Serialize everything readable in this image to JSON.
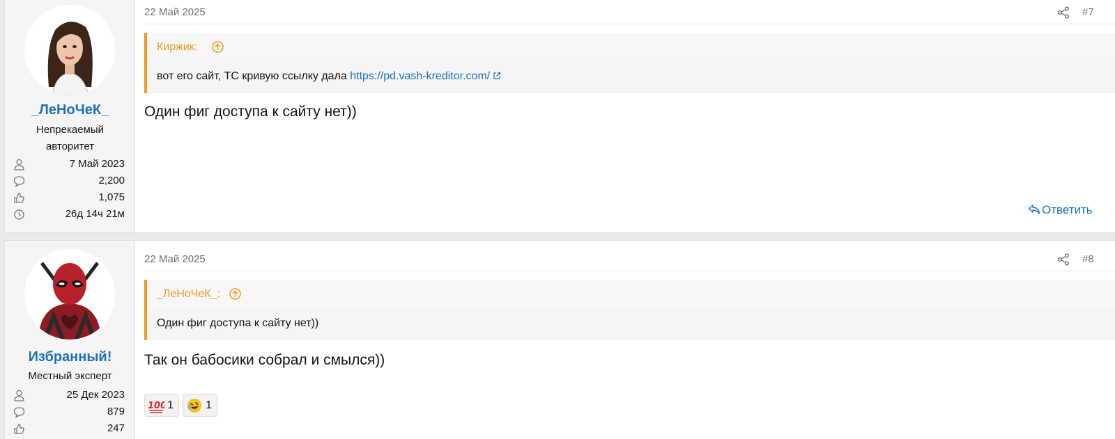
{
  "posts": [
    {
      "username": "_ЛеНоЧеК_",
      "user_title": "Непрекаемый авторитет",
      "stats": {
        "joined": "7 Май 2023",
        "messages": "2,200",
        "reactions": "1,075",
        "online": "26д 14ч 21м"
      },
      "date": "22 Май 2025",
      "post_number": "#7",
      "quote": {
        "author": "Киржик:",
        "text": "вот его сайт, ТС кривую ссылку дала ",
        "link": "https://pd.vash-kreditor.com/"
      },
      "message": "Один фиг доступа к сайту нет))",
      "reply_label": "Ответить"
    },
    {
      "username": "Избранный!",
      "user_title": "Местный эксперт",
      "stats": {
        "joined": "25 Дек 2023",
        "messages": "879",
        "reactions": "247"
      },
      "date": "22 Май 2025",
      "post_number": "#8",
      "quote": {
        "author": "_ЛеНоЧеК_:",
        "text": "Один фиг доступа к сайту нет))"
      },
      "message": "Так он бабосики собрал и смылся))",
      "reactions": [
        {
          "icon": "hundred-points-emoji",
          "count": "1"
        },
        {
          "icon": "rofl-emoji",
          "count": "1"
        }
      ]
    }
  ],
  "colors": {
    "link": "#1f72b8",
    "quote_accent": "#f09a22",
    "meta_text": "#6f6f6f"
  }
}
